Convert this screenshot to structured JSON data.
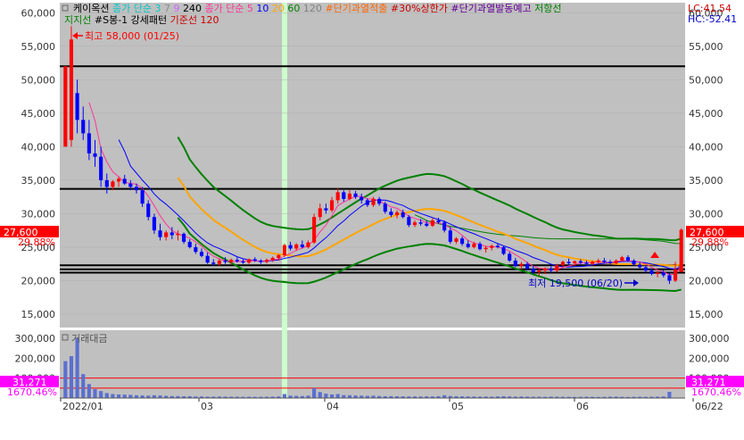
{
  "legend": {
    "row1": [
      {
        "text": "케이옥션",
        "color": "#000000"
      },
      {
        "text": "종가 단순 3",
        "color": "#00c8c8"
      },
      {
        "text": "7",
        "color": "#8c8c8c"
      },
      {
        "text": "9",
        "color": "#cc66ff"
      },
      {
        "text": "240",
        "color": "#000000"
      },
      {
        "text": "종가 단순 5",
        "color": "#ff3399"
      },
      {
        "text": "10",
        "color": "#0000ff"
      },
      {
        "text": "20",
        "color": "#ffa500"
      },
      {
        "text": "60",
        "color": "#008000"
      },
      {
        "text": "120",
        "color": "#808080"
      },
      {
        "text": "#단기과열적출",
        "color": "#ff6600"
      },
      {
        "text": "#30%상한가",
        "color": "#cc0000"
      },
      {
        "text": "#단기과열발동예고",
        "color": "#660099"
      },
      {
        "text": "저항선",
        "color": "#008000"
      }
    ],
    "row2": [
      {
        "text": "지지선",
        "color": "#008000"
      },
      {
        "text": "#S봉-1 강세패턴",
        "color": "#000000"
      },
      {
        "text": "기준선 120",
        "color": "#cc0000"
      }
    ],
    "lc": "LC:41.54",
    "hc": "HC:-52.41"
  },
  "annotations": {
    "high": "최고 58,000 (01/25)",
    "low": "최저 19,500 (06/20)"
  },
  "price_badge": {
    "value": "27,600",
    "pct": "29.88%"
  },
  "volume_badge": {
    "value": "31,271",
    "pct": "1670.46%"
  },
  "volume_title": "거래대금",
  "colors": {
    "up": "#ff0000",
    "down": "#0000ff",
    "bg": "#c0c0c0",
    "ma5": "#ff3399",
    "ma10": "#0000ff",
    "ma20": "#ffa500",
    "ma60": "#008000",
    "band": "#008000",
    "hline": "#000000",
    "highlight": "#ccffcc"
  },
  "chart_data": {
    "type": "candlestick",
    "price_axis": {
      "ticks": [
        15000,
        20000,
        25000,
        30000,
        35000,
        40000,
        45000,
        50000,
        55000,
        60000
      ],
      "labels": [
        "15,000",
        "20,000",
        "25,000",
        "30,000",
        "35,000",
        "40,000",
        "45,000",
        "50,000",
        "55,000",
        "60,000"
      ],
      "range": [
        13000,
        61500
      ]
    },
    "volume_axis": {
      "ticks": [
        100000,
        200000,
        300000
      ],
      "labels": [
        "100,000",
        "200,000",
        "300,000"
      ],
      "range": [
        0,
        340000
      ]
    },
    "x_labels": [
      "2022/01",
      "03",
      "04",
      "05",
      "06",
      "06/22"
    ],
    "horizontal_lines": [
      52000,
      33700,
      22300,
      21700,
      21200
    ],
    "volume_ref_lines": [
      100000,
      50000
    ],
    "high": {
      "value": 58000,
      "date": "01/25"
    },
    "low": {
      "value": 19500,
      "date": "06/20"
    },
    "last_close": 27600,
    "candles": [
      {
        "o": 40000,
        "h": 52000,
        "l": 40000,
        "c": 52000
      },
      {
        "o": 41000,
        "h": 58000,
        "l": 40000,
        "c": 56000
      },
      {
        "o": 48000,
        "h": 50000,
        "l": 42000,
        "c": 44000
      },
      {
        "o": 44000,
        "h": 46000,
        "l": 41000,
        "c": 42000
      },
      {
        "o": 42000,
        "h": 44000,
        "l": 38000,
        "c": 39000
      },
      {
        "o": 39000,
        "h": 41000,
        "l": 37000,
        "c": 38500
      },
      {
        "o": 38500,
        "h": 40000,
        "l": 34000,
        "c": 35000
      },
      {
        "o": 35000,
        "h": 36000,
        "l": 33000,
        "c": 34000
      },
      {
        "o": 34000,
        "h": 35000,
        "l": 33500,
        "c": 34800
      },
      {
        "o": 34800,
        "h": 35500,
        "l": 34000,
        "c": 35200
      },
      {
        "o": 35200,
        "h": 35800,
        "l": 34300,
        "c": 34500
      },
      {
        "o": 34500,
        "h": 35000,
        "l": 33500,
        "c": 34000
      },
      {
        "o": 34000,
        "h": 34500,
        "l": 33000,
        "c": 33500
      },
      {
        "o": 33500,
        "h": 34000,
        "l": 31000,
        "c": 31500
      },
      {
        "o": 31500,
        "h": 32000,
        "l": 29000,
        "c": 29500
      },
      {
        "o": 29500,
        "h": 30000,
        "l": 27000,
        "c": 27500
      },
      {
        "o": 27500,
        "h": 28500,
        "l": 26000,
        "c": 26500
      },
      {
        "o": 26500,
        "h": 27500,
        "l": 26000,
        "c": 27200
      },
      {
        "o": 27200,
        "h": 28000,
        "l": 26200,
        "c": 26800
      },
      {
        "o": 26800,
        "h": 27500,
        "l": 26000,
        "c": 27000
      },
      {
        "o": 27000,
        "h": 27200,
        "l": 25500,
        "c": 25800
      },
      {
        "o": 25800,
        "h": 26200,
        "l": 24800,
        "c": 25000
      },
      {
        "o": 25000,
        "h": 25500,
        "l": 24000,
        "c": 24300
      },
      {
        "o": 24300,
        "h": 24800,
        "l": 23500,
        "c": 23700
      },
      {
        "o": 23700,
        "h": 24200,
        "l": 22500,
        "c": 22700
      },
      {
        "o": 22700,
        "h": 23200,
        "l": 22200,
        "c": 22500
      },
      {
        "o": 22500,
        "h": 23300,
        "l": 22200,
        "c": 23000
      },
      {
        "o": 23000,
        "h": 23500,
        "l": 22500,
        "c": 22800
      },
      {
        "o": 22800,
        "h": 23300,
        "l": 22500,
        "c": 23100
      },
      {
        "o": 23100,
        "h": 23500,
        "l": 22700,
        "c": 22900
      },
      {
        "o": 22900,
        "h": 23200,
        "l": 22500,
        "c": 22700
      },
      {
        "o": 22700,
        "h": 23300,
        "l": 22500,
        "c": 23200
      },
      {
        "o": 23200,
        "h": 23500,
        "l": 22800,
        "c": 23000
      },
      {
        "o": 23000,
        "h": 23200,
        "l": 22500,
        "c": 22800
      },
      {
        "o": 22800,
        "h": 23300,
        "l": 22600,
        "c": 23100
      },
      {
        "o": 23100,
        "h": 23600,
        "l": 22800,
        "c": 23400
      },
      {
        "o": 23400,
        "h": 24000,
        "l": 23000,
        "c": 23800
      },
      {
        "o": 23800,
        "h": 25500,
        "l": 23500,
        "c": 25300
      },
      {
        "o": 25300,
        "h": 25800,
        "l": 24500,
        "c": 24800
      },
      {
        "o": 24800,
        "h": 25600,
        "l": 24500,
        "c": 25400
      },
      {
        "o": 25400,
        "h": 26000,
        "l": 24800,
        "c": 25000
      },
      {
        "o": 25000,
        "h": 26000,
        "l": 24800,
        "c": 25700
      },
      {
        "o": 25700,
        "h": 30000,
        "l": 25500,
        "c": 29500
      },
      {
        "o": 29500,
        "h": 31500,
        "l": 29000,
        "c": 30800
      },
      {
        "o": 30800,
        "h": 31500,
        "l": 30000,
        "c": 30500
      },
      {
        "o": 30500,
        "h": 32500,
        "l": 30200,
        "c": 32000
      },
      {
        "o": 32000,
        "h": 33800,
        "l": 31500,
        "c": 33200
      },
      {
        "o": 33200,
        "h": 33500,
        "l": 31800,
        "c": 32200
      },
      {
        "o": 32200,
        "h": 33500,
        "l": 32000,
        "c": 33000
      },
      {
        "o": 33000,
        "h": 33400,
        "l": 32200,
        "c": 32500
      },
      {
        "o": 32500,
        "h": 33000,
        "l": 31500,
        "c": 32000
      },
      {
        "o": 32000,
        "h": 32300,
        "l": 31000,
        "c": 31300
      },
      {
        "o": 31300,
        "h": 32500,
        "l": 31000,
        "c": 32200
      },
      {
        "o": 32200,
        "h": 32500,
        "l": 31200,
        "c": 31500
      },
      {
        "o": 31500,
        "h": 31800,
        "l": 30000,
        "c": 30300
      },
      {
        "o": 30300,
        "h": 30800,
        "l": 29500,
        "c": 29800
      },
      {
        "o": 29800,
        "h": 30500,
        "l": 29300,
        "c": 30200
      },
      {
        "o": 30200,
        "h": 30600,
        "l": 29300,
        "c": 29500
      },
      {
        "o": 29500,
        "h": 29800,
        "l": 28000,
        "c": 28300
      },
      {
        "o": 28300,
        "h": 29000,
        "l": 28000,
        "c": 28700
      },
      {
        "o": 28700,
        "h": 29200,
        "l": 28200,
        "c": 28500
      },
      {
        "o": 28500,
        "h": 29000,
        "l": 28000,
        "c": 28200
      },
      {
        "o": 28200,
        "h": 29300,
        "l": 28000,
        "c": 29000
      },
      {
        "o": 29000,
        "h": 29400,
        "l": 28500,
        "c": 28700
      },
      {
        "o": 28700,
        "h": 29000,
        "l": 27200,
        "c": 27500
      },
      {
        "o": 27500,
        "h": 28000,
        "l": 25500,
        "c": 25800
      },
      {
        "o": 25800,
        "h": 26500,
        "l": 25500,
        "c": 26300
      },
      {
        "o": 26300,
        "h": 26600,
        "l": 25200,
        "c": 25500
      },
      {
        "o": 25500,
        "h": 26000,
        "l": 24800,
        "c": 25000
      },
      {
        "o": 25000,
        "h": 25800,
        "l": 24800,
        "c": 25500
      },
      {
        "o": 25500,
        "h": 25800,
        "l": 24500,
        "c": 24700
      },
      {
        "o": 24700,
        "h": 25200,
        "l": 24200,
        "c": 24900
      },
      {
        "o": 24900,
        "h": 25400,
        "l": 24500,
        "c": 25200
      },
      {
        "o": 25200,
        "h": 25600,
        "l": 24800,
        "c": 25000
      },
      {
        "o": 25000,
        "h": 25200,
        "l": 23800,
        "c": 24000
      },
      {
        "o": 24000,
        "h": 24300,
        "l": 22800,
        "c": 23000
      },
      {
        "o": 23000,
        "h": 23400,
        "l": 22000,
        "c": 22200
      },
      {
        "o": 22200,
        "h": 22800,
        "l": 21700,
        "c": 22500
      },
      {
        "o": 22500,
        "h": 22800,
        "l": 21500,
        "c": 21800
      },
      {
        "o": 21800,
        "h": 22200,
        "l": 21000,
        "c": 21300
      },
      {
        "o": 21300,
        "h": 21800,
        "l": 20800,
        "c": 21500
      },
      {
        "o": 21500,
        "h": 22000,
        "l": 21000,
        "c": 21800
      },
      {
        "o": 21800,
        "h": 22200,
        "l": 21200,
        "c": 21500
      },
      {
        "o": 21500,
        "h": 22500,
        "l": 21300,
        "c": 22300
      },
      {
        "o": 22300,
        "h": 23000,
        "l": 22000,
        "c": 22800
      },
      {
        "o": 22800,
        "h": 23300,
        "l": 22300,
        "c": 22600
      },
      {
        "o": 22600,
        "h": 23000,
        "l": 22200,
        "c": 22900
      },
      {
        "o": 22900,
        "h": 23200,
        "l": 22400,
        "c": 22700
      },
      {
        "o": 22700,
        "h": 23000,
        "l": 22200,
        "c": 22500
      },
      {
        "o": 22500,
        "h": 23000,
        "l": 22300,
        "c": 22800
      },
      {
        "o": 22800,
        "h": 23300,
        "l": 22500,
        "c": 23000
      },
      {
        "o": 23000,
        "h": 23400,
        "l": 22600,
        "c": 22800
      },
      {
        "o": 22800,
        "h": 23100,
        "l": 22300,
        "c": 22600
      },
      {
        "o": 22600,
        "h": 23200,
        "l": 22400,
        "c": 23000
      },
      {
        "o": 23000,
        "h": 23700,
        "l": 22800,
        "c": 23500
      },
      {
        "o": 23500,
        "h": 23800,
        "l": 22800,
        "c": 23000
      },
      {
        "o": 23000,
        "h": 23200,
        "l": 22200,
        "c": 22400
      },
      {
        "o": 22400,
        "h": 22800,
        "l": 21800,
        "c": 22000
      },
      {
        "o": 22000,
        "h": 22300,
        "l": 21200,
        "c": 21500
      },
      {
        "o": 21500,
        "h": 21800,
        "l": 20800,
        "c": 21000
      },
      {
        "o": 21000,
        "h": 21500,
        "l": 20500,
        "c": 21200
      },
      {
        "o": 21200,
        "h": 21600,
        "l": 20500,
        "c": 20800
      },
      {
        "o": 20800,
        "h": 21200,
        "l": 19500,
        "c": 20000
      },
      {
        "o": 20000,
        "h": 22800,
        "l": 19800,
        "c": 21700
      },
      {
        "o": 21300,
        "h": 27800,
        "l": 21300,
        "c": 27600
      }
    ],
    "volumes": [
      185000,
      210000,
      300000,
      120000,
      70000,
      45000,
      35000,
      25000,
      20000,
      18000,
      17000,
      16000,
      14000,
      13000,
      12000,
      14000,
      13000,
      11000,
      10000,
      10000,
      9000,
      9000,
      8000,
      8000,
      7000,
      7000,
      7500,
      7000,
      6500,
      6500,
      6000,
      6500,
      6000,
      6000,
      6500,
      7000,
      8000,
      20000,
      12000,
      11000,
      10000,
      12000,
      50000,
      30000,
      22000,
      18000,
      20000,
      15000,
      14000,
      13000,
      12000,
      11000,
      12000,
      10000,
      9000,
      9500,
      9000,
      8500,
      8000,
      8000,
      7500,
      8500,
      8000,
      9000,
      14000,
      10000,
      9000,
      8500,
      8000,
      7500,
      7000,
      7500,
      7000,
      8000,
      9000,
      8000,
      7000,
      7500,
      7000,
      6500,
      6500,
      6000,
      7000,
      6500,
      6000,
      6000,
      5500,
      6000,
      6500,
      6000,
      5500,
      6000,
      6500,
      7000,
      6000,
      5500,
      6000,
      6500,
      6000,
      6500,
      7000,
      8000,
      31271
    ]
  }
}
